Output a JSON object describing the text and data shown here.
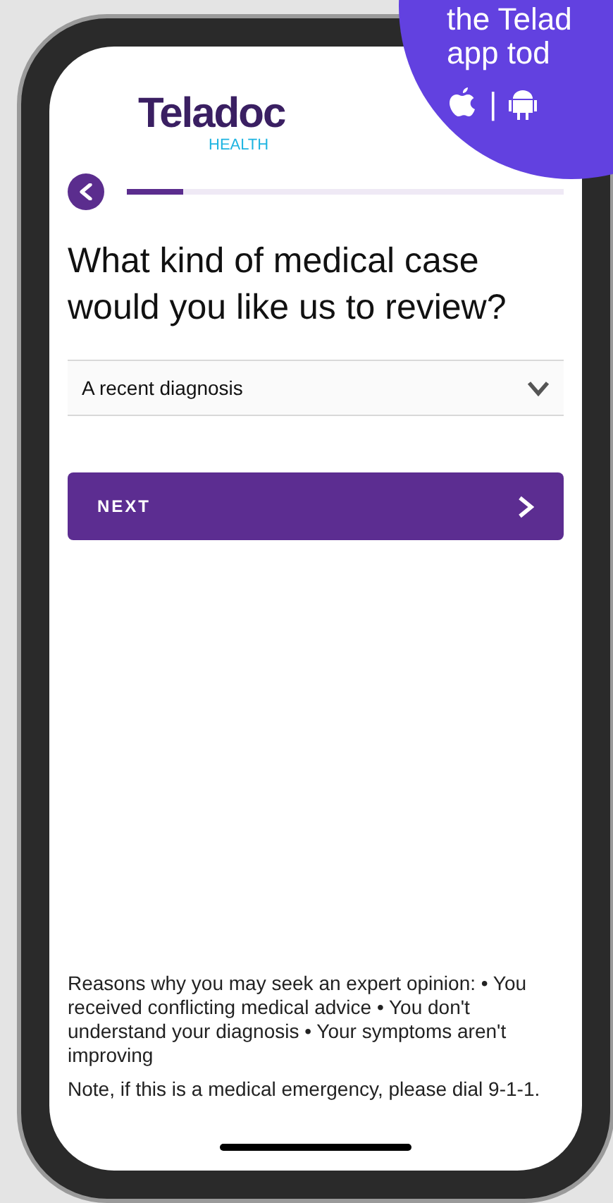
{
  "promo": {
    "lines": [
      "the Telad",
      "app tod"
    ],
    "separator": "|"
  },
  "logo": {
    "name": "Teladoc",
    "sub": "HEALTH"
  },
  "progress": {
    "level": 0.13
  },
  "question": "What kind of medical case would you like us to review?",
  "dropdown": {
    "value": "A recent diagnosis"
  },
  "next_button": {
    "label": "NEXT"
  },
  "info": [
    "Reasons why you may seek an expert opinion: • You received conflicting medical advice • You don't understand your diagnosis • Your symptoms aren't improving",
    "Note, if this is a medical emergency, please dial 9-1-1."
  ]
}
